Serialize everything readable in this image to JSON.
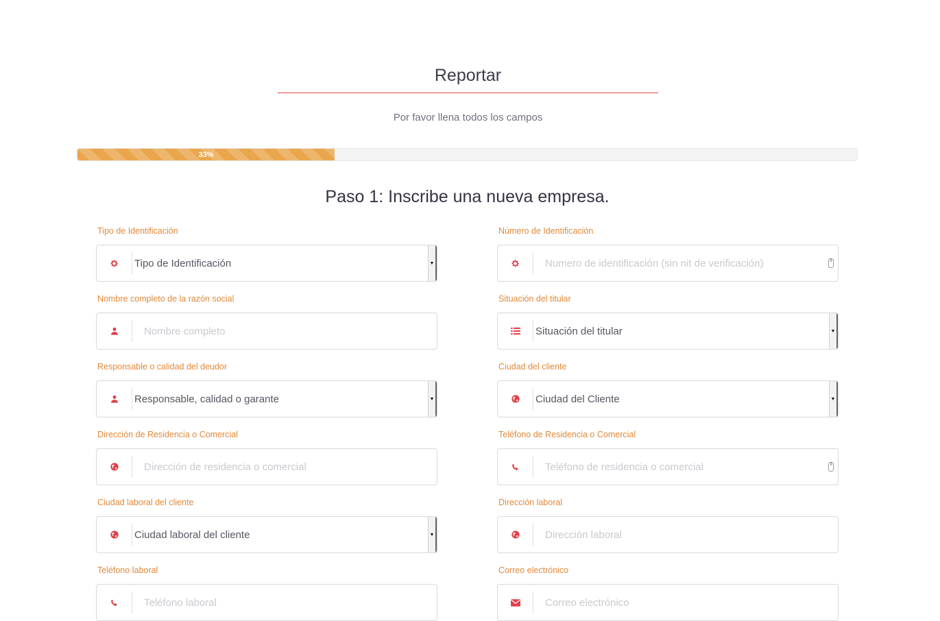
{
  "header": {
    "title": "Reportar",
    "subtitle": "Por favor llena todos los campos"
  },
  "progress": {
    "value_percent": 33,
    "label": "33%",
    "color": "#eaa64d"
  },
  "step": {
    "title": "Paso 1: Inscribe una nueva empresa."
  },
  "colors": {
    "accent": "#e0414a",
    "label": "#e0893a"
  },
  "form": {
    "tipo_id": {
      "label": "Tipo de Identificación",
      "value": "Tipo de Identificación",
      "icon": "gear-icon"
    },
    "numero_id": {
      "label": "Número de Identificación",
      "placeholder": "Numero de identificación (sin nit de verificación)",
      "icon": "gear-icon"
    },
    "nombre": {
      "label": "Nombre completo de la razón social",
      "placeholder": "Nombre completo",
      "icon": "user-icon"
    },
    "situacion": {
      "label": "Situación del titular",
      "value": "Situación del titular",
      "icon": "list-icon"
    },
    "responsable": {
      "label": "Responsable o calidad del deudor",
      "value": "Responsable, calidad o garante",
      "icon": "user-icon"
    },
    "ciudad_cliente": {
      "label": "Ciudad del cliente",
      "value": "Ciudad del Cliente",
      "icon": "globe-icon"
    },
    "direccion_res": {
      "label": "Dirección de Residencia o Comercial",
      "placeholder": "Dirección de residencia o comercial",
      "icon": "globe-icon"
    },
    "telefono_res": {
      "label": "Teléfono de Residencia o Comercial",
      "placeholder": "Teléfono de residencia o comercial",
      "icon": "phone-icon"
    },
    "ciudad_laboral": {
      "label": "Ciudad laboral del cliente",
      "value": "Ciudad laboral del cliente",
      "icon": "globe-icon"
    },
    "direccion_laboral": {
      "label": "Dirección laboral",
      "placeholder": "Dirección laboral",
      "icon": "globe-icon"
    },
    "telefono_laboral": {
      "label": "Teléfono laboral",
      "placeholder": "Teléfono laboral",
      "icon": "phone-icon"
    },
    "correo": {
      "label": "Correo electrónico",
      "placeholder": "Correo electrónico",
      "icon": "envelope-icon"
    }
  }
}
